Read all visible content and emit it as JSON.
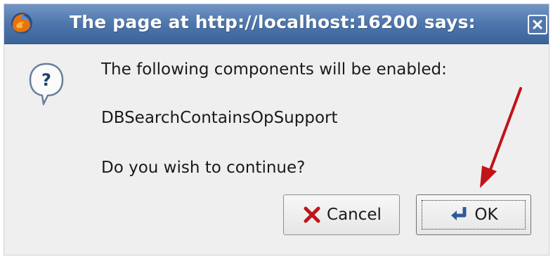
{
  "dialog": {
    "title": "The page at http://localhost:16200 says:",
    "message_line1": "The following components will be enabled:",
    "message_line2": "DBSearchContainsOpSupport",
    "message_line3": "Do you wish to continue?",
    "icon": "question-icon",
    "app_icon": "firefox-icon"
  },
  "buttons": {
    "cancel_label": "Cancel",
    "ok_label": "OK"
  },
  "colors": {
    "titlebar": "#4f77ad",
    "dialog_bg": "#efefef",
    "annotation_arrow": "#c0141a",
    "cancel_x": "#c0141a"
  }
}
